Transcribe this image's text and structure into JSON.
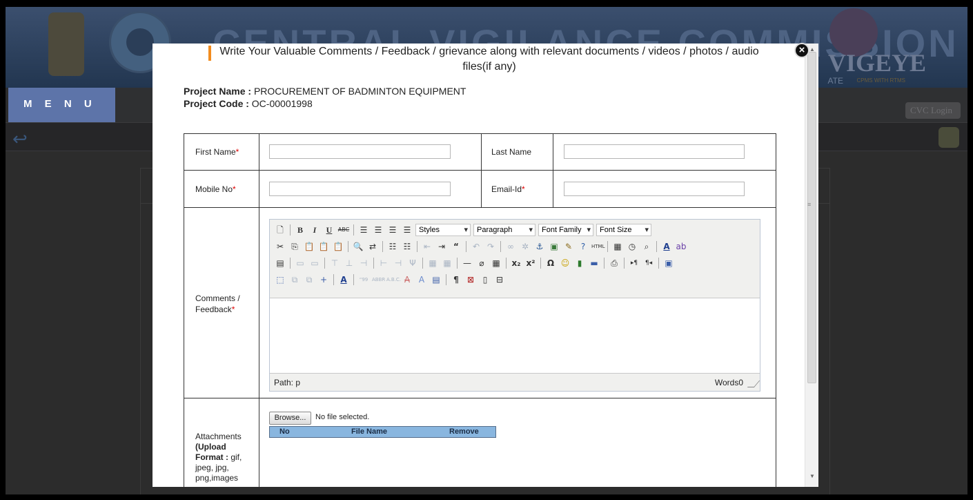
{
  "background": {
    "header_watermark": "CENTRAL VIGILANCE COMMISSION",
    "logo_text": "CENTRAL VIGILANCE CO",
    "vigeye_label": "VIGEYE",
    "vigeye_sub": "CPMS WITH RTMS",
    "ate_label": "ATE",
    "menu_label": "M E N U",
    "cvc_login_label": "CVC Login"
  },
  "modal": {
    "title": "Write Your Valuable Comments / Feedback / grievance along with relevant documents / videos / photos / audio files(if any)",
    "close_glyph": "×",
    "project_name_label": "Project Name :",
    "project_name_value": "PROCUREMENT OF BADMINTON EQUIPMENT",
    "project_code_label": "Project Code :",
    "project_code_value": "OC-00001998",
    "fields": {
      "first_name_label": "First Name",
      "last_name_label": "Last Name",
      "mobile_label": "Mobile No",
      "email_label": "Email-Id",
      "comments_label": "Comments / Feedback",
      "required_mark": "*",
      "first_name_value": "",
      "last_name_value": "",
      "mobile_value": "",
      "email_value": ""
    },
    "editor": {
      "styles_label": "Styles",
      "paragraph_label": "Paragraph",
      "font_family_label": "Font Family",
      "font_size_label": "Font Size",
      "path_label": "Path: p",
      "words_label": "Words0"
    },
    "attachments": {
      "label_prefix": "Attachments",
      "label_bold": "(Upload Format :",
      "label_rest": "gif, jpeg, jpg, png,images",
      "browse_label": "Browse...",
      "no_file_text": "No file selected.",
      "col_no": "No",
      "col_file_name": "File Name",
      "col_remove": "Remove"
    }
  },
  "colors": {
    "accent_orange": "#f28c1f",
    "menu_blue": "#5d74a9",
    "attach_header": "#89b6df",
    "required_red": "#dd0000"
  }
}
